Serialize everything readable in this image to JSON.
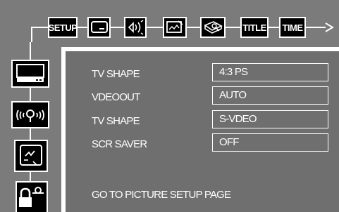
{
  "menu": {
    "tabs": [
      {
        "label": "SETUP",
        "icon": "setup-text"
      },
      {
        "label": "",
        "icon": "tv-screen-icon"
      },
      {
        "label": "",
        "icon": "speaker-sound-icon"
      },
      {
        "label": "",
        "icon": "picture-icon"
      },
      {
        "label": "",
        "icon": "language-icon"
      },
      {
        "label": "TITLE",
        "icon": "title-text"
      },
      {
        "label": "TIME",
        "icon": "time-text"
      }
    ]
  },
  "sidebar": {
    "items": [
      {
        "icon": "tv-display-icon",
        "selected": true
      },
      {
        "icon": "audio-wave-icon",
        "selected": false
      },
      {
        "icon": "speech-icon",
        "selected": false
      },
      {
        "icon": "lock-key-icon",
        "selected": false
      }
    ]
  },
  "settings": [
    {
      "label": "TV SHAPE",
      "value": "4:3 PS"
    },
    {
      "label": "VDEOOUT",
      "value": "AUTO"
    },
    {
      "label": "TV SHAPE",
      "value": "S-VDEO"
    },
    {
      "label": "SCR SAVER",
      "value": "OFF"
    }
  ],
  "footer": {
    "text": "GO TO PICTURE SETUP PAGE"
  },
  "colors": {
    "background": "#7b7b7b",
    "panel": "#6f6f6f",
    "foreground": "#ffffff",
    "icon_fill": "#000000"
  }
}
